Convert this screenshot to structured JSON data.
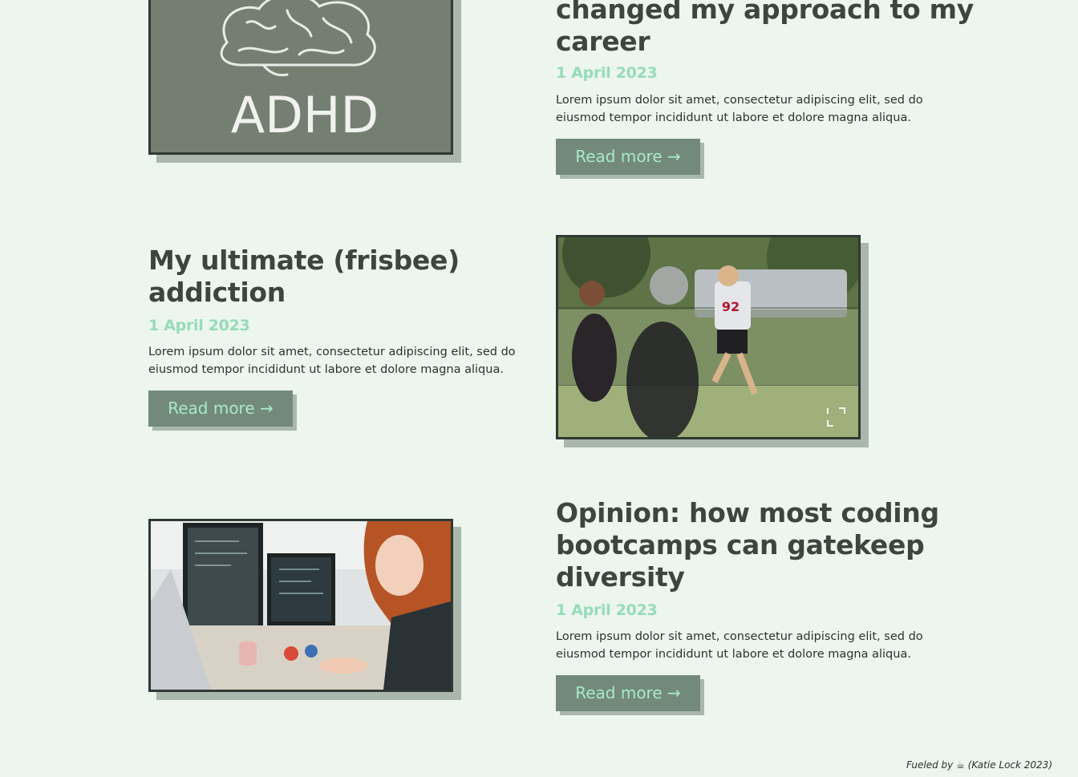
{
  "posts": [
    {
      "title_lines": [
        "changed my approach to my",
        "career"
      ],
      "date": "1 April 2023",
      "excerpt_lines": [
        "Lorem ipsum dolor sit amet, consectetur adipiscing elit, sed do",
        "eiusmod tempor incididunt ut labore et dolore magna aliqua."
      ],
      "button_label": "Read more →",
      "image_text": "ADHD"
    },
    {
      "title_lines": [
        "My ultimate (frisbee)",
        "addiction"
      ],
      "date": "1 April 2023",
      "excerpt_lines": [
        "Lorem ipsum dolor sit amet, consectetur adipiscing elit, sed do",
        "eiusmod tempor incididunt ut labore et dolore magna aliqua."
      ],
      "button_label": "Read more →",
      "image_text": "92"
    },
    {
      "title_lines": [
        "Opinion: how most coding",
        "bootcamps can gatekeep",
        "diversity"
      ],
      "date": "1 April 2023",
      "excerpt_lines": [
        "Lorem ipsum dolor sit amet, consectetur adipiscing elit, sed do",
        "eiusmod tempor incididunt ut labore et dolore magna aliqua."
      ],
      "button_label": "Read more →"
    }
  ],
  "footer": {
    "prefix": "Fueled by",
    "icon": "coffee-icon",
    "icon_glyph": "☕",
    "suffix": "(Katie Lock 2023)"
  },
  "colors": {
    "background": "#edf5ef",
    "accent_green": "#96dcb6",
    "button_bg": "#738a7b",
    "button_text": "#a9e9c6",
    "shadow": "#a9b7ad",
    "frame": "#2f3a33"
  }
}
